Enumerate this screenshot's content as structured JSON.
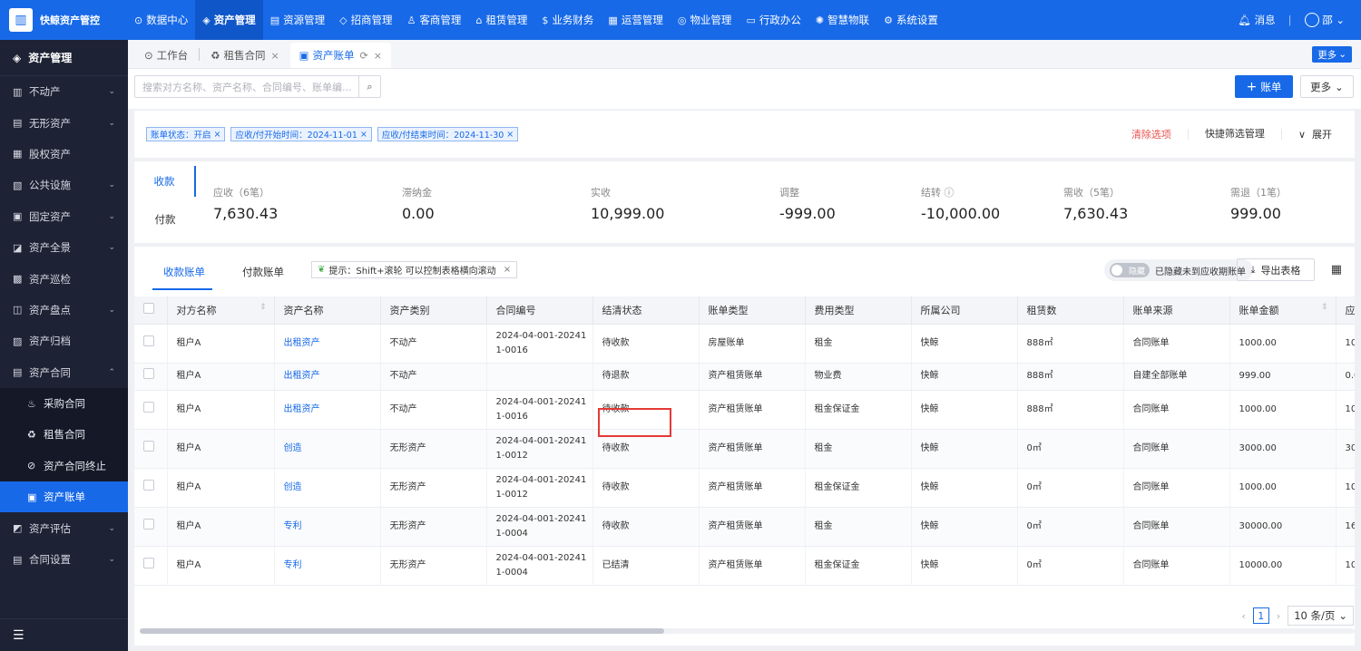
{
  "app": {
    "name": "快鲸资产管控"
  },
  "topnav": [
    {
      "icon": "⊙",
      "label": "数据中心"
    },
    {
      "icon": "◈",
      "label": "资产管理",
      "active": true
    },
    {
      "icon": "▤",
      "label": "资源管理"
    },
    {
      "icon": "◇",
      "label": "招商管理"
    },
    {
      "icon": "♙",
      "label": "客商管理"
    },
    {
      "icon": "⌂",
      "label": "租赁管理"
    },
    {
      "icon": "$",
      "label": "业务财务"
    },
    {
      "icon": "▦",
      "label": "运营管理"
    },
    {
      "icon": "◎",
      "label": "物业管理"
    },
    {
      "icon": "▭",
      "label": "行政办公"
    },
    {
      "icon": "✺",
      "label": "智慧物联"
    },
    {
      "icon": "⚙",
      "label": "系统设置"
    }
  ],
  "top_right": {
    "messages": "消息",
    "user": "邵"
  },
  "sidebar": {
    "title": "资产管理",
    "items": [
      {
        "icon": "▥",
        "label": "不动产",
        "chevron": "⌄"
      },
      {
        "icon": "▤",
        "label": "无形资产",
        "chevron": "⌄"
      },
      {
        "icon": "▦",
        "label": "股权资产",
        "chevron": ""
      },
      {
        "icon": "▧",
        "label": "公共设施",
        "chevron": "⌄"
      },
      {
        "icon": "▣",
        "label": "固定资产",
        "chevron": "⌄"
      },
      {
        "icon": "◪",
        "label": "资产全景",
        "chevron": "⌄"
      },
      {
        "icon": "▩",
        "label": "资产巡检",
        "chevron": ""
      },
      {
        "icon": "◫",
        "label": "资产盘点",
        "chevron": "⌄"
      },
      {
        "icon": "▨",
        "label": "资产归档",
        "chevron": ""
      },
      {
        "icon": "▤",
        "label": "资产合同",
        "chevron": "⌃"
      }
    ],
    "sub_items": [
      {
        "icon": "♨",
        "label": "采购合同"
      },
      {
        "icon": "♻",
        "label": "租售合同"
      },
      {
        "icon": "⊘",
        "label": "资产合同终止"
      },
      {
        "icon": "▣",
        "label": "资产账单",
        "active": true
      }
    ],
    "items_after": [
      {
        "icon": "◩",
        "label": "资产评估",
        "chevron": "⌄"
      },
      {
        "icon": "▤",
        "label": "合同设置",
        "chevron": "⌄"
      }
    ],
    "collapse_icon": "☰"
  },
  "tabs": [
    {
      "icon": "⊙",
      "label": "工作台",
      "closable": false
    },
    {
      "icon": "♻",
      "label": "租售合同",
      "closable": true
    },
    {
      "icon": "▣",
      "label": "资产账单",
      "closable": true,
      "active": true
    }
  ],
  "tab_more": "更多",
  "search": {
    "placeholder": "搜索对方名称、资产名称、合同编号、账单编..."
  },
  "toolbar": {
    "add_label": "账单",
    "more_label": "更多"
  },
  "filters": {
    "chips": [
      "账单状态：开启",
      "应收/付开始时间：2024-11-01",
      "应收/付结束时间：2024-11-30"
    ],
    "clear": "清除选项",
    "manage": "快捷筛选管理",
    "expand": "展开"
  },
  "summary": {
    "tabs": [
      "收款",
      "付款"
    ],
    "stats": [
      {
        "label": "应收（6笔）",
        "value": "7,630.43"
      },
      {
        "label": "滞纳金",
        "value": "0.00"
      },
      {
        "label": "实收",
        "value": "10,999.00"
      },
      {
        "label": "调整",
        "value": "-999.00"
      },
      {
        "label": "结转 ⓘ",
        "value": "-10,000.00"
      },
      {
        "label": "需收（5笔）",
        "value": "7,630.43"
      },
      {
        "label": "需退（1笔）",
        "value": "999.00"
      }
    ]
  },
  "table_panel": {
    "subtabs": [
      "收款账单",
      "付款账单"
    ],
    "hint": "提示：Shift+滚轮 可以控制表格横向滚动",
    "toggle_state": "隐藏",
    "toggle_label": "已隐藏未到应收期账单",
    "export": "导出表格"
  },
  "table": {
    "columns": [
      "对方名称",
      "资产名称",
      "资产类别",
      "合同编号",
      "结清状态",
      "账单类型",
      "费用类型",
      "所属公司",
      "租赁数",
      "账单来源",
      "账单金额",
      "应"
    ],
    "rows": [
      [
        "租户A",
        "出租资产",
        "不动产",
        "2024-04-001-202411-0016",
        "待收款",
        "房屋账单",
        "租金",
        "快鲸",
        "888㎡",
        "合同账单",
        "1000.00",
        "10"
      ],
      [
        "租户A",
        "出租资产",
        "不动产",
        "",
        "待退款",
        "资产租赁账单",
        "物业费",
        "快鲸",
        "888㎡",
        "自建全部账单",
        "999.00",
        "0.0"
      ],
      [
        "租户A",
        "出租资产",
        "不动产",
        "2024-04-001-202411-0016",
        "待收款",
        "资产租赁账单",
        "租金保证金",
        "快鲸",
        "888㎡",
        "合同账单",
        "1000.00",
        "10"
      ],
      [
        "租户A",
        "创造",
        "无形资产",
        "2024-04-001-202411-0012",
        "待收款",
        "资产租赁账单",
        "租金",
        "快鲸",
        "0㎡",
        "合同账单",
        "3000.00",
        "30"
      ],
      [
        "租户A",
        "创造",
        "无形资产",
        "2024-04-001-202411-0012",
        "待收款",
        "资产租赁账单",
        "租金保证金",
        "快鲸",
        "0㎡",
        "合同账单",
        "1000.00",
        "10"
      ],
      [
        "租户A",
        "专利",
        "无形资产",
        "2024-04-001-202411-0004",
        "待收款",
        "资产租赁账单",
        "租金",
        "快鲸",
        "0㎡",
        "合同账单",
        "30000.00",
        "16"
      ],
      [
        "租户A",
        "专利",
        "无形资产",
        "2024-04-001-202411-0004",
        "已结清",
        "资产租赁账单",
        "租金保证金",
        "快鲸",
        "0㎡",
        "合同账单",
        "10000.00",
        "10"
      ]
    ]
  },
  "pager": {
    "current": "1",
    "page_size": "10 条/页"
  },
  "colors": {
    "primary": "#1769e8",
    "sidebar_bg": "#1d2234",
    "danger": "#e53935"
  }
}
